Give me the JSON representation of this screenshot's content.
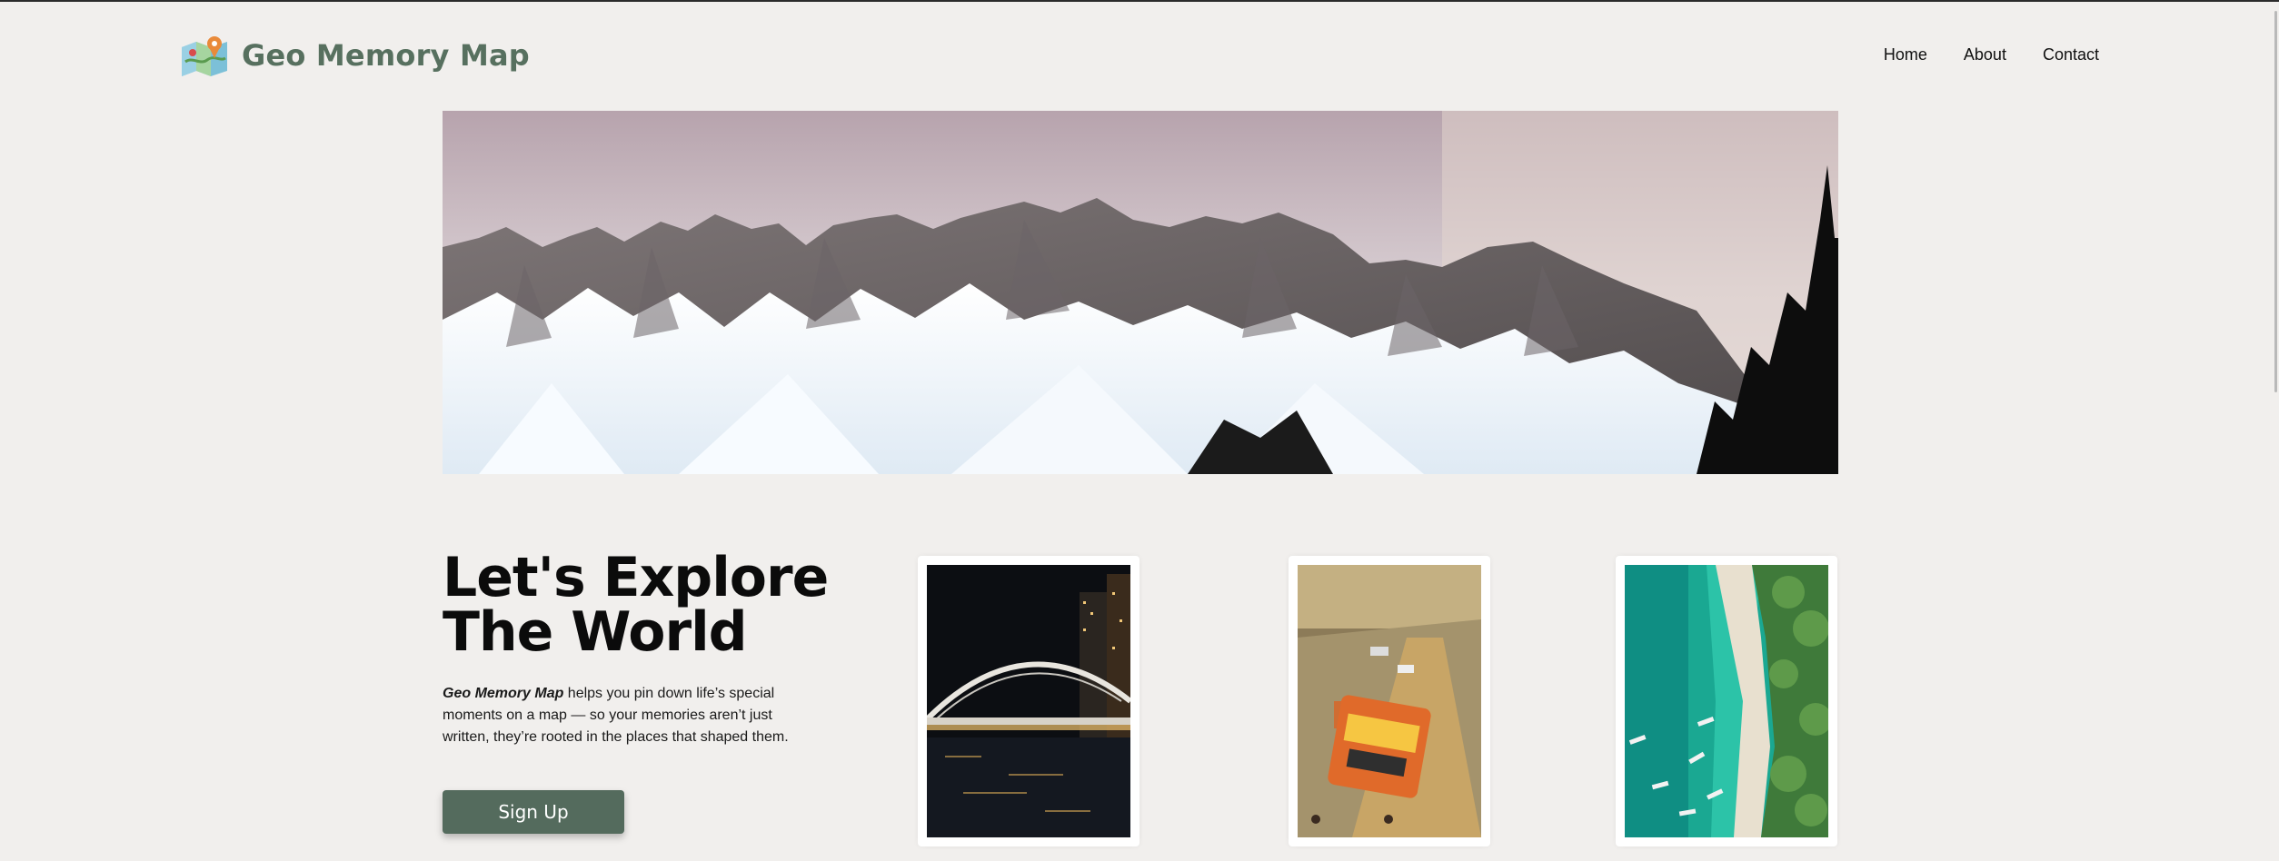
{
  "brand": {
    "name": "Geo Memory Map",
    "icon": "folded-map-icon"
  },
  "nav": {
    "items": [
      "Home",
      "About",
      "Contact"
    ]
  },
  "hero": {
    "image": "snowy-mountain-range-photo"
  },
  "intro": {
    "headline_line1": "Let's Explore",
    "headline_line2": "The World",
    "desc_brand": "Geo Memory Map",
    "desc_rest": " helps you pin down life’s special moments on a map — so your memories aren’t just written, they’re rooted in the places that shaped them.",
    "signup_label": "Sign Up"
  },
  "gallery": [
    "night-bridge-photo",
    "city-street-bus-photo",
    "aerial-beach-photo"
  ],
  "colors": {
    "accent": "#546b5d",
    "brand_text": "#57705f",
    "background": "#f1efed"
  }
}
